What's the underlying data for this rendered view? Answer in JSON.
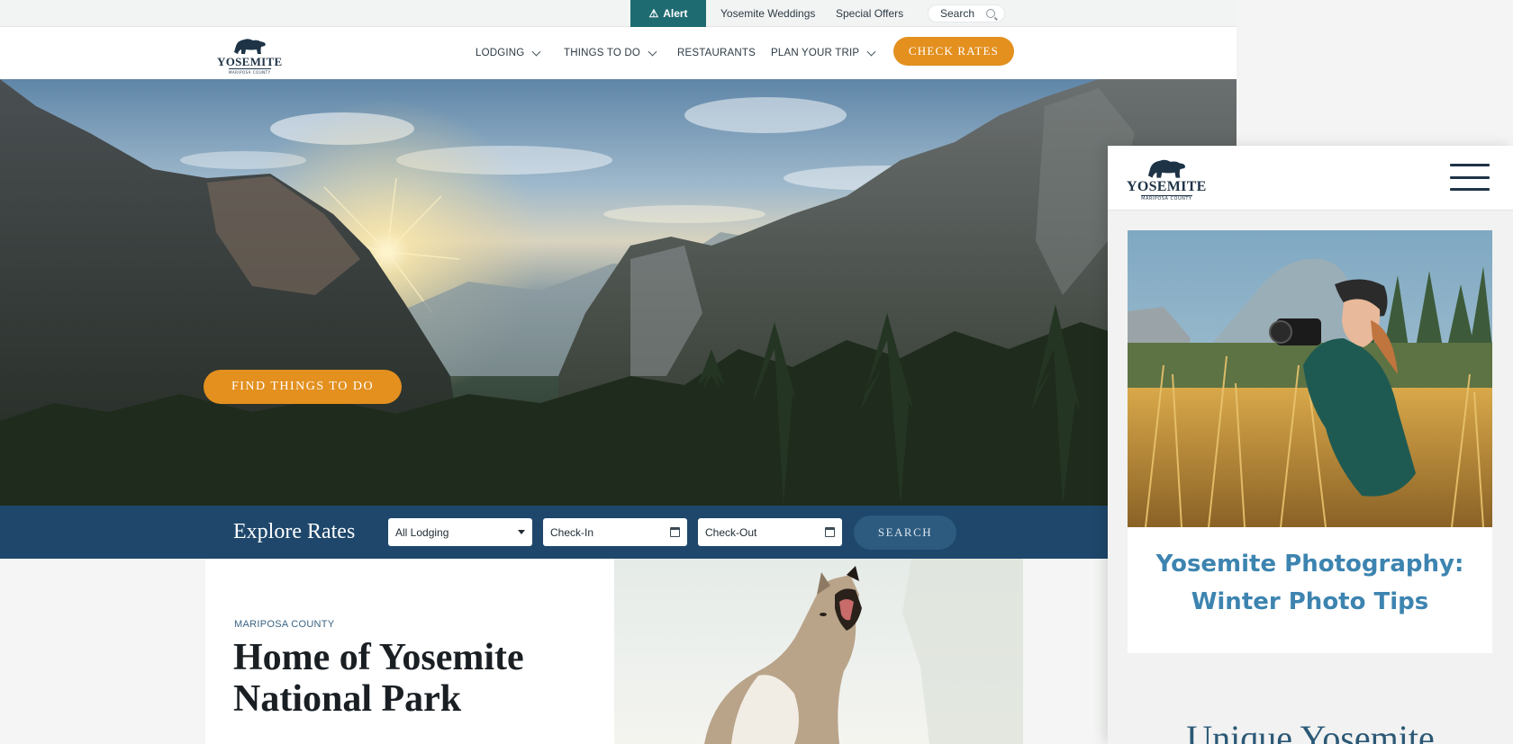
{
  "desktop": {
    "utility": {
      "alert_label": "Alert",
      "weddings": "Yosemite Weddings",
      "offers": "Special Offers",
      "search": "Search"
    },
    "logo": {
      "name": "YOSEMITE",
      "sub": "MARIPOSA COUNTY"
    },
    "nav": {
      "items": [
        {
          "label": "LODGING",
          "dropdown": true
        },
        {
          "label": "THINGS TO DO",
          "dropdown": true
        },
        {
          "label": "RESTAURANTS",
          "dropdown": false
        },
        {
          "label": "PLAN YOUR TRIP",
          "dropdown": true
        }
      ],
      "cta": "CHECK RATES"
    },
    "hero": {
      "cta": "FIND THINGS TO DO"
    },
    "rates": {
      "title": "Explore Rates",
      "lodging": "All Lodging",
      "check_in": "Check-In",
      "check_out": "Check-Out",
      "search": "SEARCH"
    },
    "intro": {
      "eyebrow": "MARIPOSA COUNTY",
      "title": "Home of Yosemite National Park"
    }
  },
  "mobile": {
    "logo": {
      "name": "YOSEMITE",
      "sub": "MARIPOSA COUNTY"
    },
    "article_title": "Yosemite Photography: Winter Photo Tips",
    "section_heading": "Unique Yosemite"
  },
  "colors": {
    "accent_orange": "#e3901f",
    "navy": "#1e476b",
    "teal": "#1f6b72",
    "link_blue": "#3d84b0"
  }
}
